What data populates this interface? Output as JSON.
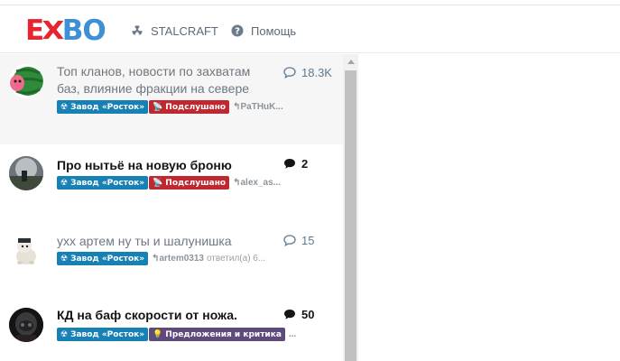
{
  "brand": {
    "logo_e": "E",
    "logo_x": "X",
    "logo_bo": "BO",
    "colors": {
      "red": "#e8242c",
      "blue": "#3d8fd6"
    }
  },
  "nav": [
    {
      "label": "STALCRAFT",
      "icon": "radiation-icon"
    },
    {
      "label": "Помощь",
      "icon": "question-circle-icon"
    }
  ],
  "threads": [
    {
      "title": "Топ кланов, новости по захватам баз, влияние фракции на севере",
      "title_line1": "Топ кланов, новости по захватам",
      "title_line2": "баз, влияние фракции на севере",
      "count": "18.3K",
      "unread": false,
      "tags": [
        "Завод «Росток»",
        "Подслушано"
      ],
      "last_poster": "PaTHuK...",
      "reply_text": ""
    },
    {
      "title": "Про нытьё на новую броню",
      "count": "2",
      "unread": true,
      "tags": [
        "Завод «Росток»",
        "Подслушано"
      ],
      "last_poster": "alex_as...",
      "reply_text": ""
    },
    {
      "title": "ухх артем ну ты и шалунишка",
      "count": "15",
      "unread": false,
      "tags": [
        "Завод «Росток»"
      ],
      "last_poster": "artem0313",
      "reply_text": "ответил(а) 6..."
    },
    {
      "title": "КД на баф скорости от ножа.",
      "count": "50",
      "unread": true,
      "tags": [
        "Завод «Росток»",
        "Предложения и критика"
      ],
      "last_poster": "",
      "reply_text": "..."
    }
  ]
}
